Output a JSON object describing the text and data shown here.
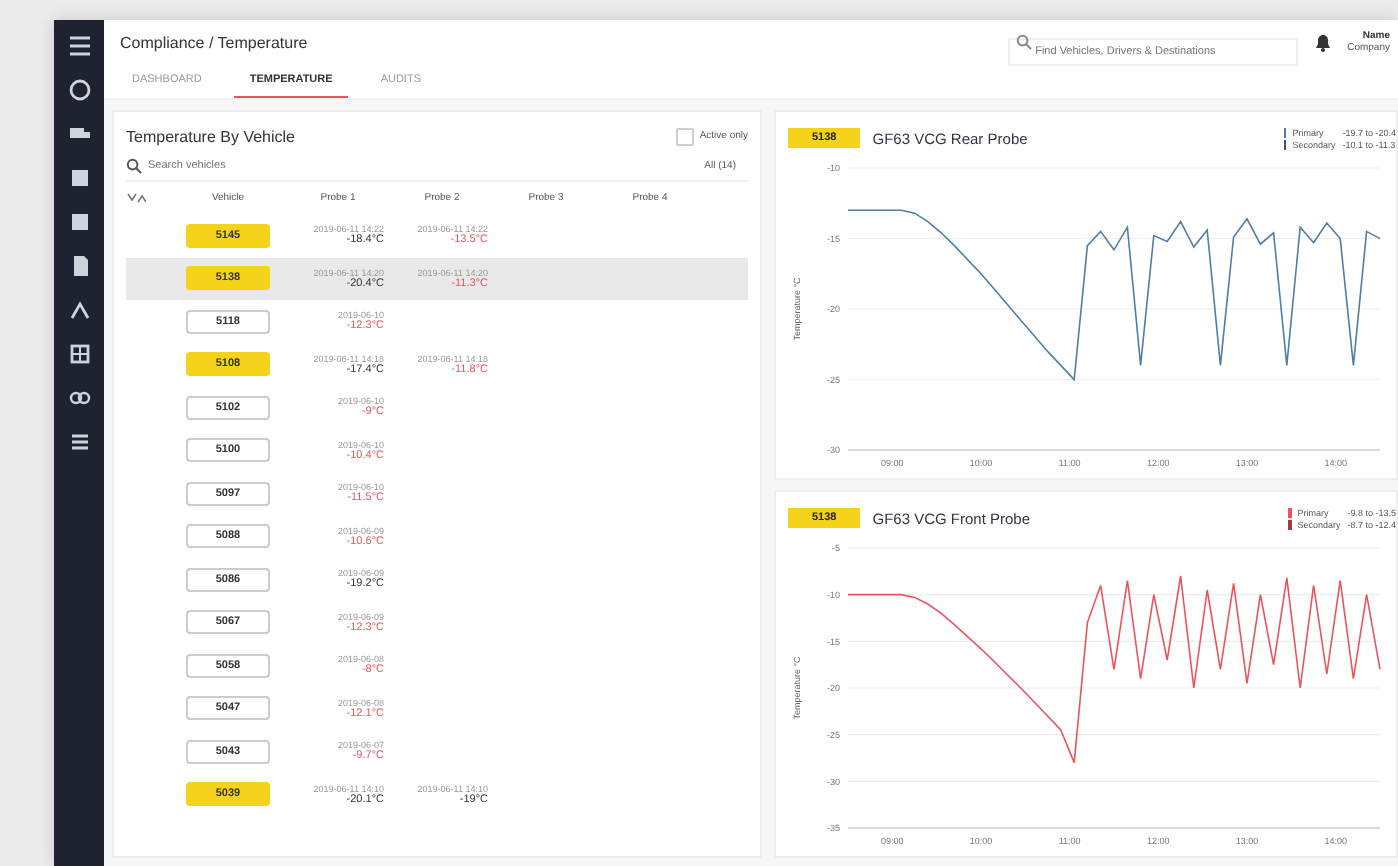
{
  "breadcrumb": "Compliance / Temperature",
  "search": {
    "placeholder": "Find Vehicles, Drivers & Destinations"
  },
  "user": {
    "name": "Name",
    "company": "Company"
  },
  "tabs": [
    {
      "label": "DASHBOARD",
      "selected": false
    },
    {
      "label": "TEMPERATURE",
      "selected": true
    },
    {
      "label": "AUDITS",
      "selected": false
    }
  ],
  "vehicle_panel": {
    "title": "Temperature By Vehicle",
    "active_only": {
      "label": "Active only",
      "checked": false
    },
    "search": {
      "placeholder": "Search vehicles"
    },
    "count": "All (14)",
    "columns": [
      "Vehicle",
      "Probe 1",
      "Probe 2",
      "Probe 3",
      "Probe 4"
    ],
    "rows": [
      {
        "vehicle": "5145",
        "active": true,
        "selected": false,
        "probe_1": {
          "time": "2019-06-11 14:22",
          "temp": "-18.4°C",
          "alert": false
        },
        "probe_2": {
          "time": "2019-06-11 14:22",
          "temp": "-13.5°C",
          "alert": true
        }
      },
      {
        "vehicle": "5138",
        "active": true,
        "selected": true,
        "probe_1": {
          "time": "2019-06-11 14:20",
          "temp": "-20.4°C",
          "alert": false
        },
        "probe_2": {
          "time": "2019-06-11 14:20",
          "temp": "-11.3°C",
          "alert": true
        }
      },
      {
        "vehicle": "5118",
        "active": false,
        "selected": false,
        "probe_1": {
          "time": "2019-06-10",
          "temp": "-12.3°C",
          "alert": true
        }
      },
      {
        "vehicle": "5108",
        "active": true,
        "selected": false,
        "probe_1": {
          "time": "2019-06-11 14:18",
          "temp": "-17.4°C",
          "alert": false
        },
        "probe_2": {
          "time": "2019-06-11 14:18",
          "temp": "-11.8°C",
          "alert": true
        }
      },
      {
        "vehicle": "5102",
        "active": false,
        "selected": false,
        "probe_1": {
          "time": "2019-06-10",
          "temp": "-9°C",
          "alert": true
        }
      },
      {
        "vehicle": "5100",
        "active": false,
        "selected": false,
        "probe_1": {
          "time": "2019-06-10",
          "temp": "-10.4°C",
          "alert": true
        }
      },
      {
        "vehicle": "5097",
        "active": false,
        "selected": false,
        "probe_1": {
          "time": "2019-06-10",
          "temp": "-11.5°C",
          "alert": true
        }
      },
      {
        "vehicle": "5088",
        "active": false,
        "selected": false,
        "probe_1": {
          "time": "2019-06-09",
          "temp": "-10.6°C",
          "alert": true
        }
      },
      {
        "vehicle": "5086",
        "active": false,
        "selected": false,
        "probe_1": {
          "time": "2019-06-09",
          "temp": "-19.2°C",
          "alert": false
        }
      },
      {
        "vehicle": "5067",
        "active": false,
        "selected": false,
        "probe_1": {
          "time": "2019-06-09",
          "temp": "-12.3°C",
          "alert": true
        }
      },
      {
        "vehicle": "5058",
        "active": false,
        "selected": false,
        "probe_1": {
          "time": "2019-06-08",
          "temp": "-8°C",
          "alert": true
        }
      },
      {
        "vehicle": "5047",
        "active": false,
        "selected": false,
        "probe_1": {
          "time": "2019-06-08",
          "temp": "-12.1°C",
          "alert": true
        }
      },
      {
        "vehicle": "5043",
        "active": false,
        "selected": false,
        "probe_1": {
          "time": "2019-06-07",
          "temp": "-9.7°C",
          "alert": true
        }
      },
      {
        "vehicle": "5039",
        "active": true,
        "selected": false,
        "probe_1": {
          "time": "2019-06-11 14:10",
          "temp": "-20.1°C",
          "alert": false
        },
        "probe_2": {
          "time": "2019-06-11 14:10",
          "temp": "-19°C",
          "alert": false
        }
      }
    ]
  },
  "charts": [
    {
      "badge": "5138",
      "title": "GF63 VCG Rear Probe",
      "legend": [
        {
          "value": "-19.7 to -20.4"
        },
        {
          "label": "Secondary",
          "value": "-10.1 to -11.3"
        }
      ],
      "chart_data": {
        "type": "line",
        "grid": true,
        "ylabel": "Temperature °C",
        "xlim": [
          8.5,
          14.5
        ],
        "ylim": [
          -30,
          -10
        ],
        "yticks": [
          -10,
          -15,
          -20,
          -25,
          -30
        ],
        "xticks": [
          {
            "value": 9,
            "label": "09:00"
          },
          {
            "value": 10,
            "label": "10:00"
          },
          {
            "value": 11,
            "label": "11:00"
          },
          {
            "value": 12,
            "label": "12:00"
          },
          {
            "value": 13,
            "label": "13:00"
          },
          {
            "value": 14,
            "label": "14:00"
          }
        ],
        "x": [
          8.5,
          8.65,
          8.8,
          8.95,
          9.1,
          9.25,
          9.4,
          9.55,
          9.7,
          9.85,
          10,
          10.15,
          10.3,
          10.45,
          10.6,
          10.75,
          10.9,
          11.05,
          11.2,
          11.35,
          11.5,
          11.65,
          11.8,
          11.95,
          12.1,
          12.25,
          12.4,
          12.55,
          12.7,
          12.85,
          13,
          13.15,
          13.3,
          13.45,
          13.6,
          13.75,
          13.9,
          14.05,
          14.2,
          14.35,
          14.5
        ],
        "series": [
          {
            "name": "Primary",
            "color": "#4f7fa8",
            "values": [
              -13,
              -13,
              -13,
              -13,
              -13,
              -13.2,
              -13.8,
              -14.6,
              -15.5,
              -16.5,
              -17.5,
              -18.6,
              -19.7,
              -20.8,
              -21.9,
              -23,
              -24,
              -25,
              -15.5,
              -14.5,
              -15.8,
              -14.2,
              -24,
              -14.8,
              -15.2,
              -13.8,
              -15.6,
              -14.4,
              -24,
              -14.9,
              -13.6,
              -15.4,
              -14.6,
              -24,
              -14.2,
              -15.3,
              -13.9,
              -15,
              -24,
              -14.5,
              -15
            ]
          }
        ]
      }
    },
    {
      "badge": "5138",
      "title": "GF63 VCG Front Probe",
      "legend": [
        {
          "value": "-9.8 to -13.5"
        },
        {
          "label": "Secondary",
          "value": "-8.7 to -12.4"
        }
      ],
      "chart_data": {
        "type": "line",
        "grid": true,
        "ylabel": "Temperature °C",
        "xlim": [
          8.5,
          14.5
        ],
        "ylim": [
          -35,
          -5
        ],
        "yticks": [
          -5,
          -10,
          -15,
          -20,
          -25,
          -30,
          -35
        ],
        "xticks": [
          {
            "value": 9,
            "label": "09:00"
          },
          {
            "value": 10,
            "label": "10:00"
          },
          {
            "value": 11,
            "label": "11:00"
          },
          {
            "value": 12,
            "label": "12:00"
          },
          {
            "value": 13,
            "label": "13:00"
          },
          {
            "value": 14,
            "label": "14:00"
          }
        ],
        "x": [
          8.5,
          8.65,
          8.8,
          8.95,
          9.1,
          9.25,
          9.4,
          9.55,
          9.7,
          9.85,
          10,
          10.15,
          10.3,
          10.45,
          10.6,
          10.75,
          10.9,
          11.05,
          11.2,
          11.35,
          11.5,
          11.65,
          11.8,
          11.95,
          12.1,
          12.25,
          12.4,
          12.55,
          12.7,
          12.85,
          13,
          13.15,
          13.3,
          13.45,
          13.6,
          13.75,
          13.9,
          14.05,
          14.2,
          14.35,
          14.5
        ],
        "series": [
          {
            "name": "Primary",
            "color": "#e8555d",
            "values": [
              -10,
              -10,
              -10,
              -10,
              -10,
              -10.3,
              -11,
              -12,
              -13.2,
              -14.5,
              -15.8,
              -17.2,
              -18.6,
              -20,
              -21.5,
              -23,
              -24.5,
              -28,
              -13,
              -9,
              -18,
              -8.5,
              -19,
              -10,
              -17,
              -8,
              -20,
              -9.5,
              -18,
              -8.8,
              -19.5,
              -10,
              -17.5,
              -8.2,
              -20,
              -9,
              -18.5,
              -8.5,
              -19,
              -10,
              -18
            ]
          }
        ]
      }
    }
  ]
}
